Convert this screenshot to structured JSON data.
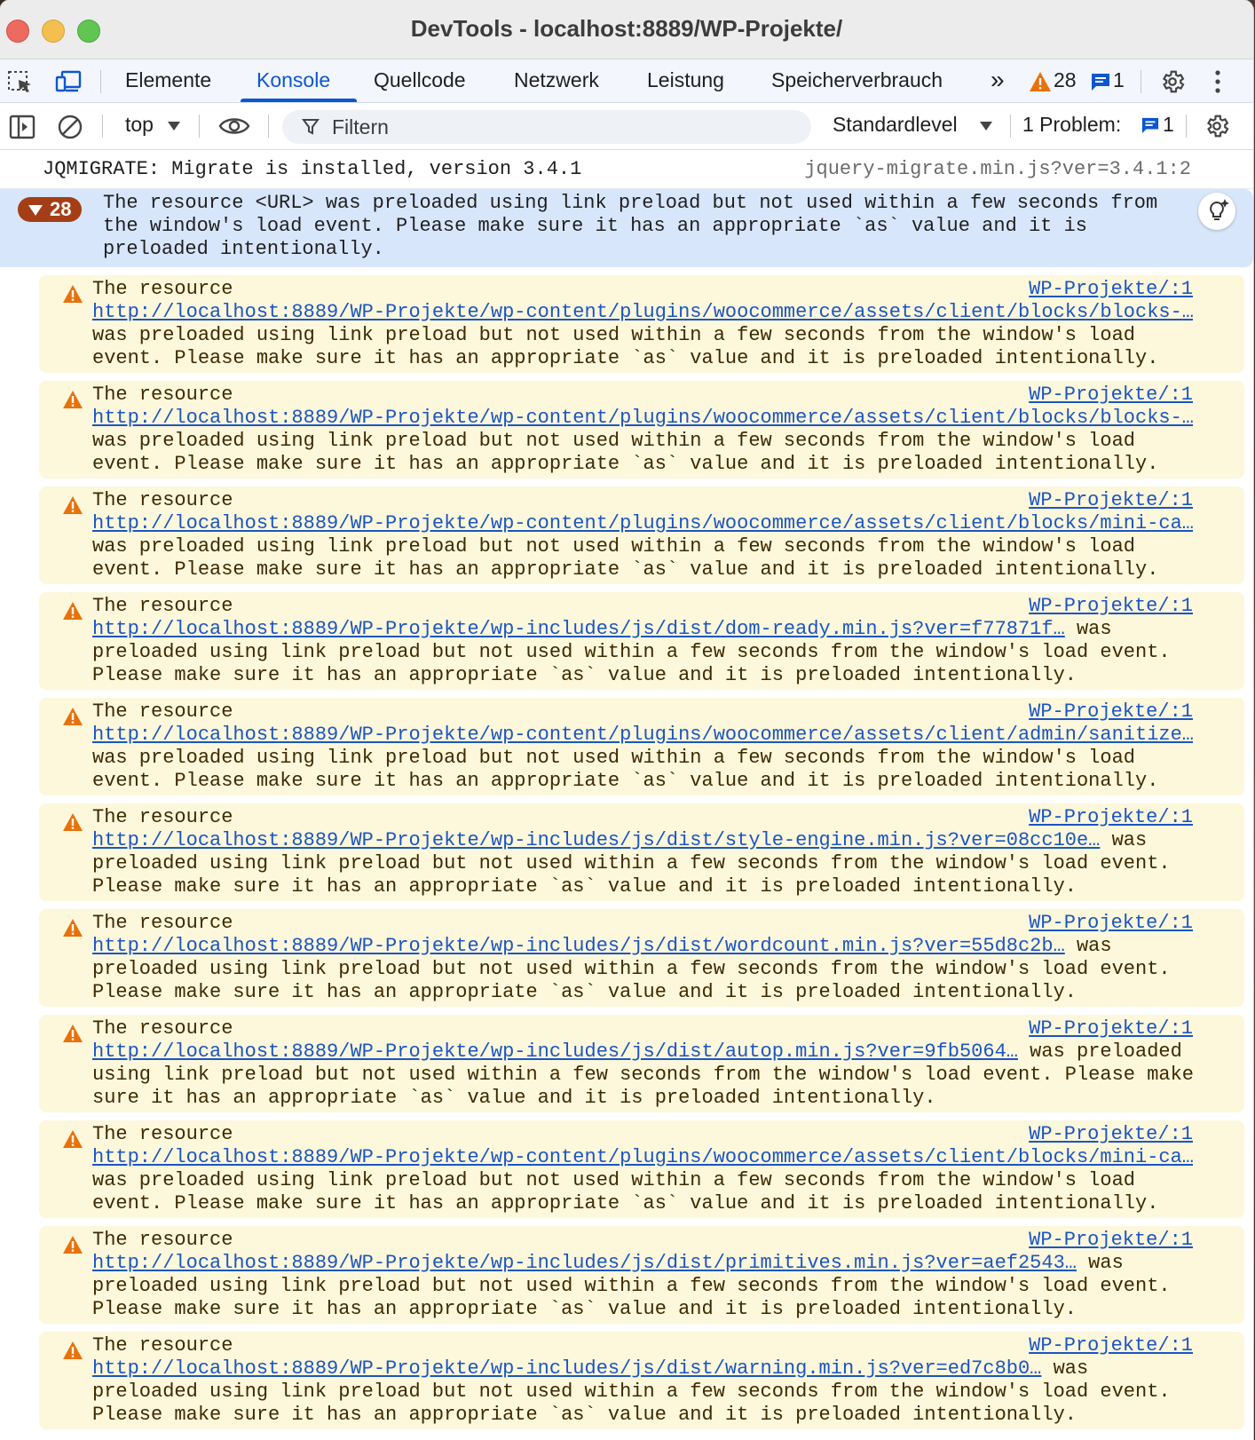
{
  "window": {
    "title": "DevTools - localhost:8889/WP-Projekte/"
  },
  "tabs": [
    {
      "label": "Elemente"
    },
    {
      "label": "Konsole",
      "active": true
    },
    {
      "label": "Quellcode"
    },
    {
      "label": "Netzwerk"
    },
    {
      "label": "Leistung"
    },
    {
      "label": "Speicherverbrauch"
    }
  ],
  "tabbar": {
    "more": "»",
    "warning_count": "28",
    "message_count": "1"
  },
  "toolbar": {
    "context": "top",
    "filter_placeholder": "Filtern",
    "level": "Standardlevel",
    "problems_label": "1 Problem:",
    "problems_count": "1"
  },
  "console": {
    "info_message": "JQMIGRATE: Migrate is installed, version 3.4.1",
    "info_source": "jquery-migrate.min.js?ver=3.4.1:2",
    "group": {
      "count": "28",
      "message": "The resource <URL> was preloaded using link preload but not used within a few seconds from\nthe window's load event. Please make sure it has an appropriate `as` value and it is\npreloaded intentionally."
    },
    "warnings": [
      {
        "source": "WP-Projekte/:1",
        "line1": "The resource",
        "url": "http://localhost:8889/WP-Projekte/wp-content/plugins/woocommerce/assets/client/blocks/blocks-…",
        "url_tail": "",
        "line3": "was preloaded using link preload but not used within a few seconds from the window's load",
        "line4": "event. Please make sure it has an appropriate `as` value and it is preloaded intentionally."
      },
      {
        "source": "WP-Projekte/:1",
        "line1": "The resource",
        "url": "http://localhost:8889/WP-Projekte/wp-content/plugins/woocommerce/assets/client/blocks/blocks-…",
        "url_tail": "",
        "line3": "was preloaded using link preload but not used within a few seconds from the window's load",
        "line4": "event. Please make sure it has an appropriate `as` value and it is preloaded intentionally."
      },
      {
        "source": "WP-Projekte/:1",
        "line1": "The resource",
        "url": "http://localhost:8889/WP-Projekte/wp-content/plugins/woocommerce/assets/client/blocks/mini-ca…",
        "url_tail": "",
        "line3": "was preloaded using link preload but not used within a few seconds from the window's load",
        "line4": "event. Please make sure it has an appropriate `as` value and it is preloaded intentionally."
      },
      {
        "source": "WP-Projekte/:1",
        "line1": "The resource",
        "url": "http://localhost:8889/WP-Projekte/wp-includes/js/dist/dom-ready.min.js?ver=f77871f…",
        "url_tail": " was",
        "line3": "preloaded using link preload but not used within a few seconds from the window's load event.",
        "line4": "Please make sure it has an appropriate `as` value and it is preloaded intentionally."
      },
      {
        "source": "WP-Projekte/:1",
        "line1": "The resource",
        "url": "http://localhost:8889/WP-Projekte/wp-content/plugins/woocommerce/assets/client/admin/sanitize…",
        "url_tail": "",
        "line3": "was preloaded using link preload but not used within a few seconds from the window's load",
        "line4": "event. Please make sure it has an appropriate `as` value and it is preloaded intentionally."
      },
      {
        "source": "WP-Projekte/:1",
        "line1": "The resource",
        "url": "http://localhost:8889/WP-Projekte/wp-includes/js/dist/style-engine.min.js?ver=08cc10e…",
        "url_tail": " was",
        "line3": "preloaded using link preload but not used within a few seconds from the window's load event.",
        "line4": "Please make sure it has an appropriate `as` value and it is preloaded intentionally."
      },
      {
        "source": "WP-Projekte/:1",
        "line1": "The resource",
        "url": "http://localhost:8889/WP-Projekte/wp-includes/js/dist/wordcount.min.js?ver=55d8c2b…",
        "url_tail": " was",
        "line3": "preloaded using link preload but not used within a few seconds from the window's load event.",
        "line4": "Please make sure it has an appropriate `as` value and it is preloaded intentionally."
      },
      {
        "source": "WP-Projekte/:1",
        "line1": "The resource",
        "url": "http://localhost:8889/WP-Projekte/wp-includes/js/dist/autop.min.js?ver=9fb5064…",
        "url_tail": " was preloaded",
        "line3": "using link preload but not used within a few seconds from the window's load event. Please make",
        "line4": "sure it has an appropriate `as` value and it is preloaded intentionally."
      },
      {
        "source": "WP-Projekte/:1",
        "line1": "The resource",
        "url": "http://localhost:8889/WP-Projekte/wp-content/plugins/woocommerce/assets/client/blocks/mini-ca…",
        "url_tail": "",
        "line3": "was preloaded using link preload but not used within a few seconds from the window's load",
        "line4": "event. Please make sure it has an appropriate `as` value and it is preloaded intentionally."
      },
      {
        "source": "WP-Projekte/:1",
        "line1": "The resource",
        "url": "http://localhost:8889/WP-Projekte/wp-includes/js/dist/primitives.min.js?ver=aef2543…",
        "url_tail": " was",
        "line3": "preloaded using link preload but not used within a few seconds from the window's load event.",
        "line4": "Please make sure it has an appropriate `as` value and it is preloaded intentionally."
      },
      {
        "source": "WP-Projekte/:1",
        "line1": "The resource",
        "url": "http://localhost:8889/WP-Projekte/wp-includes/js/dist/warning.min.js?ver=ed7c8b0…",
        "url_tail": " was",
        "line3": "preloaded using link preload but not used within a few seconds from the window's load event.",
        "line4": "Please make sure it has an appropriate `as` value and it is preloaded intentionally."
      }
    ]
  },
  "colors": {
    "accent": "#0b57d0",
    "warning_bg": "#fdf7dc",
    "warning_icon": "#e8710a",
    "group_bg": "#d8e6fb",
    "badge_bg": "#a53e16"
  }
}
